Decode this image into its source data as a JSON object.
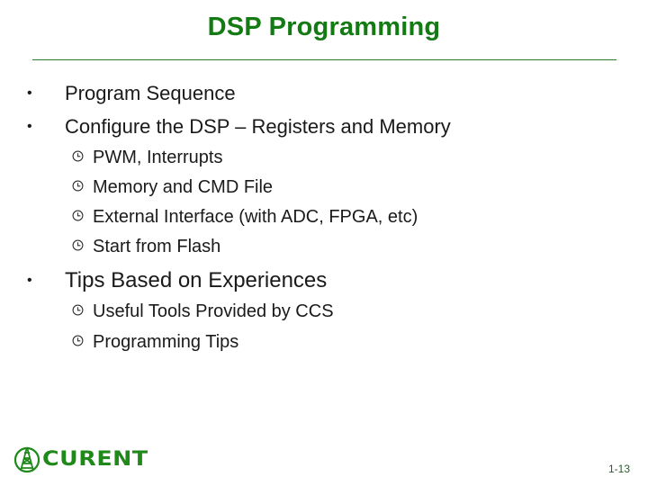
{
  "slide": {
    "title": "DSP Programming",
    "page_number": "1-13",
    "logo_text": "CURENT",
    "colors": {
      "title": "#137a14",
      "rule": "#2f7a33",
      "logo": "#1f8a1a",
      "body_text": "#1a1a1a"
    }
  },
  "content": {
    "bullet_glyph": "•",
    "items": [
      {
        "text": "Program Sequence",
        "children": []
      },
      {
        "text": "Configure the DSP – Registers and Memory",
        "children": [
          "PWM, Interrupts",
          "Memory and CMD File",
          "External Interface (with ADC, FPGA, etc)",
          "Start from Flash"
        ]
      },
      {
        "text": "Tips Based on Experiences",
        "children": [
          "Useful Tools Provided by CCS",
          "Programming Tips"
        ]
      }
    ]
  }
}
